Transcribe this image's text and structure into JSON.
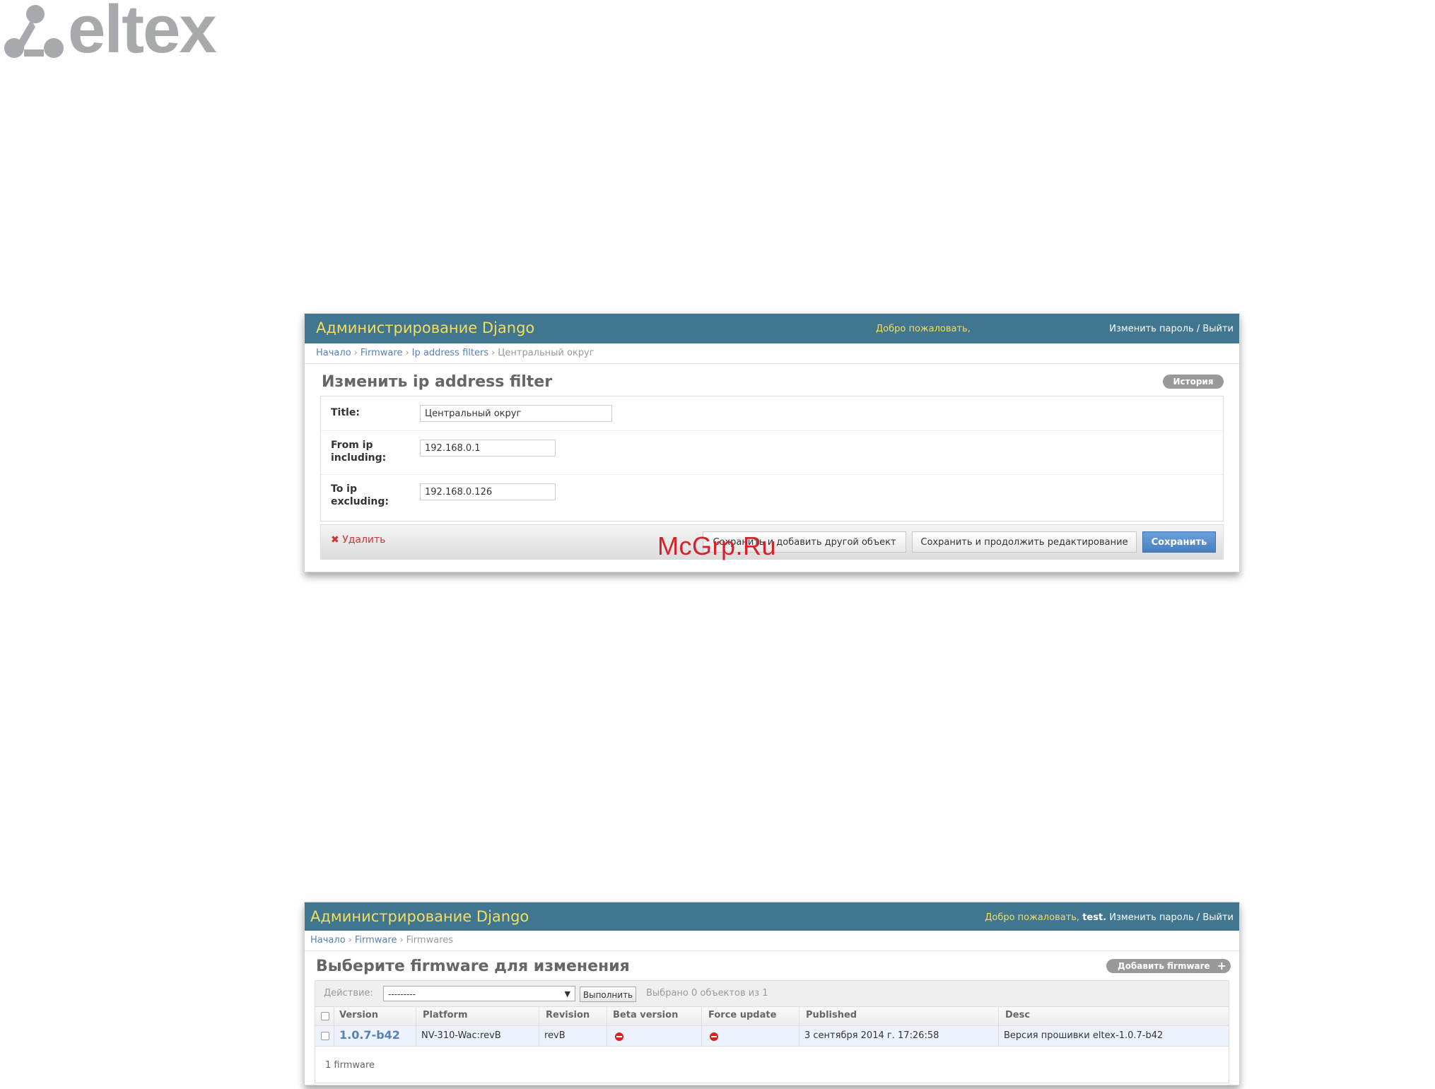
{
  "logo": {
    "text": "eltex"
  },
  "watermark": "McGrp.Ru",
  "edit_panel": {
    "header_title": "Администрирование Django",
    "welcome": "Добро пожаловать,",
    "change_password": "Изменить пароль",
    "slash": "/",
    "logout": "Выйти",
    "breadcrumbs": [
      "Начало",
      "Firmware",
      "Ip address filters",
      "Центральный округ"
    ],
    "page_title": "Изменить ip address filter",
    "history_button": "История",
    "fields": [
      {
        "label": "Title:",
        "value": "Центральный округ"
      },
      {
        "label_line1": "From ip",
        "label_line2": "including:",
        "value": "192.168.0.1"
      },
      {
        "label_line1": "To ip",
        "label_line2": "excluding:",
        "value": "192.168.0.126"
      }
    ],
    "delete_link": "Удалить",
    "save_add_another": "Сохранить и добавить другой объект",
    "save_continue": "Сохранить и продолжить редактирование",
    "save": "Сохранить"
  },
  "list_panel": {
    "header_title": "Администрирование Django",
    "welcome": "Добро пожаловать,",
    "username": "test.",
    "change_password": "Изменить пароль",
    "slash": "/",
    "logout": "Выйти",
    "breadcrumbs": [
      "Начало",
      "Firmware",
      "Firmwares"
    ],
    "page_title": "Выберите firmware для изменения",
    "add_button": "Добавить firmware",
    "action_label": "Действие:",
    "action_select_value": "---------",
    "go_button": "Выполнить",
    "selected_counter": "Выбрано 0 объектов из 1",
    "columns": [
      "Version",
      "Platform",
      "Revision",
      "Beta version",
      "Force update",
      "Published",
      "Desc"
    ],
    "rows": [
      {
        "version": "1.0.7-b42",
        "platform": "NV-310-Wac:revB",
        "revision": "revB",
        "beta_version": "no-icon",
        "force_update": "no-icon",
        "published": "3 сентября 2014 г. 17:26:58",
        "desc": "Версия прошивки eltex-1.0.7-b42"
      }
    ],
    "paginator": "1 firmware"
  },
  "colors": {
    "header_bg": "#417690",
    "header_title": "#f5dd5d",
    "link": "#5b80b2",
    "delete": "#cc3434",
    "primary_button": "#4a7fc0",
    "watermark": "#d4242a"
  }
}
